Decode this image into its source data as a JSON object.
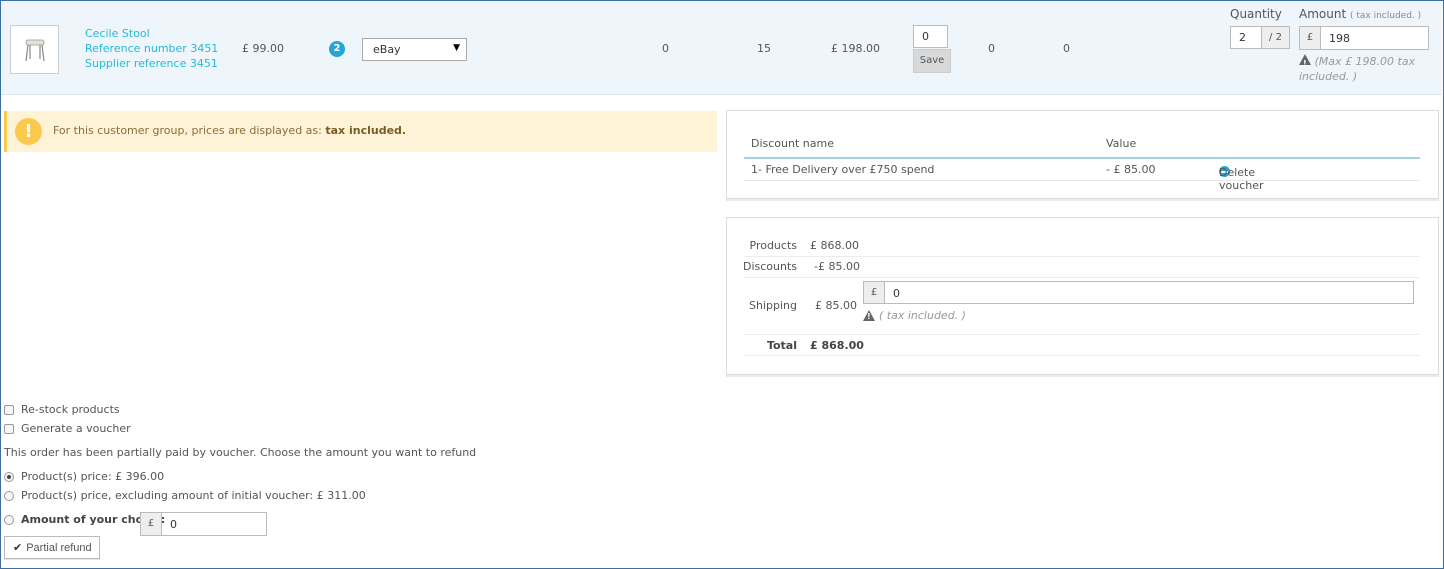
{
  "product": {
    "name": "Cecile Stool",
    "reference": "Reference number 3451",
    "supplier_reference": "Supplier reference 3451",
    "unit_price": "£ 99.00",
    "qty_badge": "2",
    "warehouse_select": "eBay",
    "col_a": "0",
    "col_b": "15",
    "total": "£ 198.00",
    "edit_qty_value": "0",
    "save_label": "Save",
    "col_c": "0",
    "col_d": "0"
  },
  "refund": {
    "quantity_label": "Quantity",
    "amount_label": "Amount",
    "amount_note": "( tax included. )",
    "quantity_value": "2",
    "quantity_max": "/ 2",
    "currency": "£",
    "amount_value": "198",
    "max_note": "(Max £ 198.00 tax included. )"
  },
  "alert": {
    "text": "For this customer group, prices are displayed as:",
    "strong": "tax included."
  },
  "discounts": {
    "header_name": "Discount name",
    "header_value": "Value",
    "rows": [
      {
        "name": "1- Free Delivery over £750 spend",
        "value": "- £ 85.00",
        "action": "Delete voucher"
      }
    ]
  },
  "totals": {
    "products_label": "Products",
    "products_value": "£ 868.00",
    "discounts_label": "Discounts",
    "discounts_value": "-£ 85.00",
    "shipping_label": "Shipping",
    "shipping_value": "£ 85.00",
    "shipping_currency": "£",
    "shipping_input": "0",
    "shipping_note": "( tax included. )",
    "total_label": "Total",
    "total_value": "£ 868.00"
  },
  "options": {
    "restock": "Re-stock products",
    "voucher": "Generate a voucher",
    "partial_note": "This order has been partially paid by voucher. Choose the amount you want to refund",
    "radio_product_price": "Product(s) price: £ 396.00",
    "radio_excluding": "Product(s) price, excluding amount of initial voucher: £ 311.00",
    "radio_choice": "Amount of your choice:",
    "choice_currency": "£",
    "choice_value": "0",
    "partial_refund_label": "Partial refund"
  }
}
